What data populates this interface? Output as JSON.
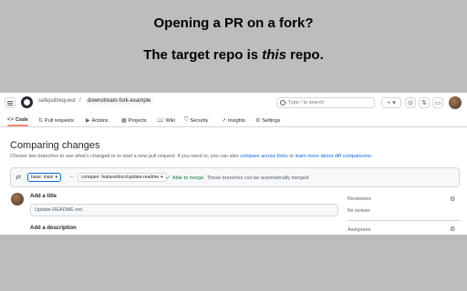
{
  "heading": {
    "line1": "Opening a PR on a fork?",
    "line2_prefix": "The target repo is ",
    "line2_emphasis": "this",
    "line2_suffix": " repo."
  },
  "topbar": {
    "owner": "safepullrequest",
    "separator": "/",
    "repo": "downstream-fork-example",
    "search_placeholder": "Type / to search",
    "plus_label": "+ ▾"
  },
  "tabs": [
    {
      "label": "Code",
      "icon": "<>"
    },
    {
      "label": "Pull requests",
      "icon": "⇅"
    },
    {
      "label": "Actions",
      "icon": "▶"
    },
    {
      "label": "Projects",
      "icon": "▦"
    },
    {
      "label": "Wiki",
      "icon": "📖"
    },
    {
      "label": "Security",
      "icon": "⛉"
    },
    {
      "label": "Insights",
      "icon": "↗"
    },
    {
      "label": "Settings",
      "icon": "⚙"
    }
  ],
  "main": {
    "title": "Comparing changes",
    "subtitle_prefix": "Choose two branches to see what’s changed or to start a new pull request. If you need to, you can also ",
    "subtitle_link1": "compare across forks",
    "subtitle_mid": " or ",
    "subtitle_link2": "learn more about diff comparisons",
    "subtitle_suffix": "."
  },
  "compare": {
    "base_label": "base: main",
    "compare_label": "compare: feature/docs/update-readme",
    "merge_status": "Able to merge.",
    "merge_detail": " These branches can be automatically merged."
  },
  "form": {
    "title_label": "Add a title",
    "title_value": "Update README.md",
    "description_label": "Add a description"
  },
  "sidebar": {
    "reviewers_label": "Reviewers",
    "reviewers_value": "No reviews",
    "assignees_label": "Assignees"
  }
}
